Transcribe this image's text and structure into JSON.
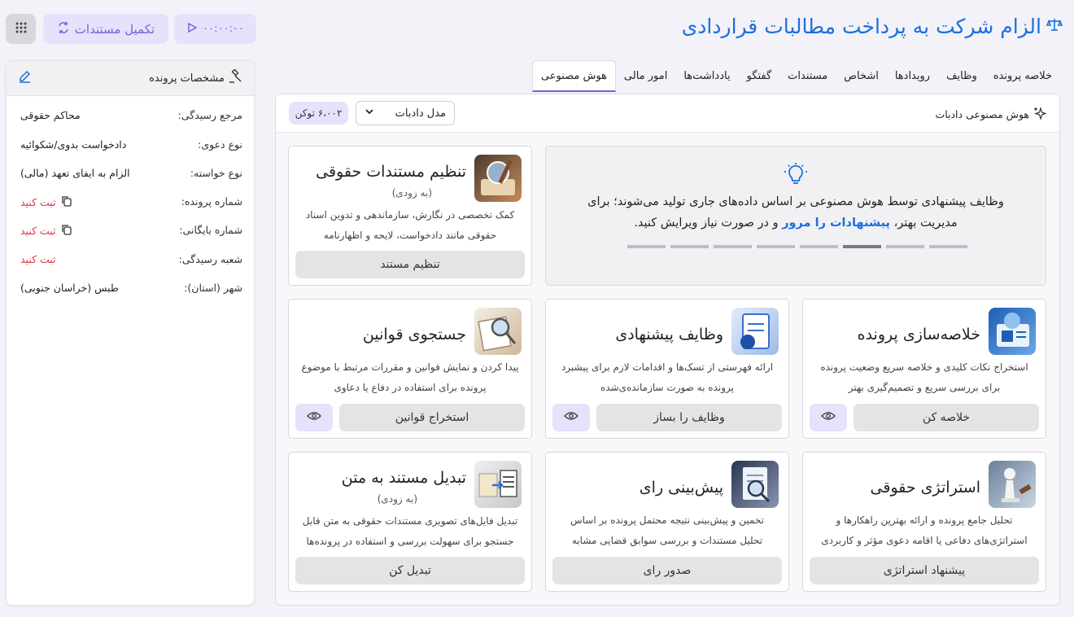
{
  "header": {
    "title": "الزام شرکت به پرداخت مطالبات قراردادی",
    "complete_docs_label": "تکمیل مستندات",
    "timer": "۰۰:۰۰:۰۰"
  },
  "sidebar": {
    "title": "مشخصات پرونده",
    "rows": [
      {
        "key": "مرجع رسیدگی:",
        "value": "محاکم حقوقی"
      },
      {
        "key": "نوع دعوی:",
        "value": "دادخواست بدوی/شکوائیه"
      },
      {
        "key": "نوع خواسته:",
        "value": "الزام به ایفای تعهد (مالی)"
      },
      {
        "key": "شماره پرونده:",
        "value": "ثبت کنید"
      },
      {
        "key": "شماره بایگانی:",
        "value": "ثبت کنید"
      },
      {
        "key": "شعبه رسیدگی:",
        "value": "ثبت کنید"
      },
      {
        "key": "شهر (استان):",
        "value": "طبس (خراسان جنوبی)"
      }
    ]
  },
  "tabs": [
    "خلاصه پرونده",
    "وظایف",
    "رویدادها",
    "اشخاص",
    "مستندات",
    "گفتگو",
    "یادداشت‌ها",
    "امور مالی",
    "هوش مصنوعی"
  ],
  "panel": {
    "title": "هوش مصنوعی دادبات",
    "model": "مدل دادبات",
    "tokens": "۶،۰۰۲ توکن"
  },
  "hero": {
    "text_before": "وظایف پیشنهادی توسط هوش مصنوعی بر اساس داده‌های جاری تولید می‌شوند؛ برای مدیریت بهتر، ",
    "link": "پیشنهادات را مرور",
    "text_after": " و در صورت نیاز ویرایش کنید."
  },
  "cards": {
    "docs": {
      "title": "تنظیم مستندات حقوقی",
      "sub": "(به زودی)",
      "desc1": "کمک تخصصی در نگارش، سازماندهی و تدوین اسناد",
      "desc2": "حقوقی مانند دادخواست، لایحه و اظهارنامه",
      "action": "تنظیم مستند"
    },
    "summary": {
      "title": "خلاصه‌سازی پرونده",
      "desc1": "استخراج نکات کلیدی و خلاصه سریع وضعیت پرونده",
      "desc2": "برای بررسی سریع و تصمیم‌گیری بهتر",
      "action": "خلاصه کن"
    },
    "tasks": {
      "title": "وظایف پیشنهادی",
      "desc1": "ارائه فهرستی از تسک‌ها و اقدامات لازم برای پیشبرد",
      "desc2": "پرونده به صورت سازمانده‌ی‌شده",
      "action": "وظایف را بساز"
    },
    "laws": {
      "title": "جستجوی قوانین",
      "desc1": "پیدا کردن و نمایش قوانین و مقررات مرتبط با موضوع",
      "desc2": "پرونده برای استفاده در دفاع یا دعاوی",
      "action": "استخراج قوانین"
    },
    "strategy": {
      "title": "استراتژی حقوقی",
      "desc1": "تحلیل جامع پرونده و ارائه بهترین راهکارها و",
      "desc2": "استراتژی‌های دفاعی یا اقامه دعوی مؤثر و کاربردی",
      "action": "پیشنهاد استراتژی"
    },
    "predict": {
      "title": "پیش‌بینی رای",
      "desc1": "تخمین و پیش‌بینی نتیجه محتمل پرونده بر اساس",
      "desc2": "تحلیل مستندات و بررسی سوابق قضایی مشابه",
      "action": "صدور رای"
    },
    "ocr": {
      "title": "تبدیل مستند به متن",
      "sub": "(به زودی)",
      "desc1": "تبدیل فایل‌های تصویری مستندات حقوقی به متن قابل",
      "desc2": "جستجو برای سهولت بررسی و استفاده در پرونده‌ها",
      "action": "تبدیل کن"
    }
  }
}
